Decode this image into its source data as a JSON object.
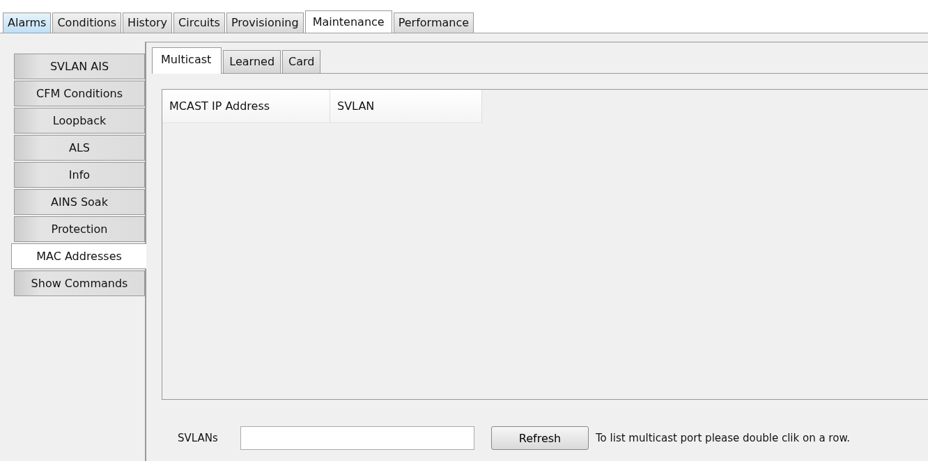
{
  "top_tabs": [
    {
      "label": "Alarms",
      "selected": false,
      "highlighted": true
    },
    {
      "label": "Conditions",
      "selected": false,
      "highlighted": false
    },
    {
      "label": "History",
      "selected": false,
      "highlighted": false
    },
    {
      "label": "Circuits",
      "selected": false,
      "highlighted": false
    },
    {
      "label": "Provisioning",
      "selected": false,
      "highlighted": false
    },
    {
      "label": "Maintenance",
      "selected": true,
      "highlighted": false
    },
    {
      "label": "Performance",
      "selected": false,
      "highlighted": false
    }
  ],
  "side_tabs": [
    {
      "label": "SVLAN AIS",
      "selected": false
    },
    {
      "label": "CFM Conditions",
      "selected": false
    },
    {
      "label": "Loopback",
      "selected": false
    },
    {
      "label": "ALS",
      "selected": false
    },
    {
      "label": "Info",
      "selected": false
    },
    {
      "label": "AINS Soak",
      "selected": false
    },
    {
      "label": "Protection",
      "selected": false
    },
    {
      "label": "MAC Addresses",
      "selected": true
    },
    {
      "label": "Show Commands",
      "selected": false
    }
  ],
  "sub_tabs": [
    {
      "label": "Multicast",
      "selected": true
    },
    {
      "label": "Learned",
      "selected": false
    },
    {
      "label": "Card",
      "selected": false
    }
  ],
  "table": {
    "columns": [
      "MCAST IP Address",
      "SVLAN"
    ]
  },
  "footer": {
    "svlans_label": "SVLANs",
    "refresh_button": "Refresh",
    "hint": "To list multicast port please double clik on a row."
  }
}
